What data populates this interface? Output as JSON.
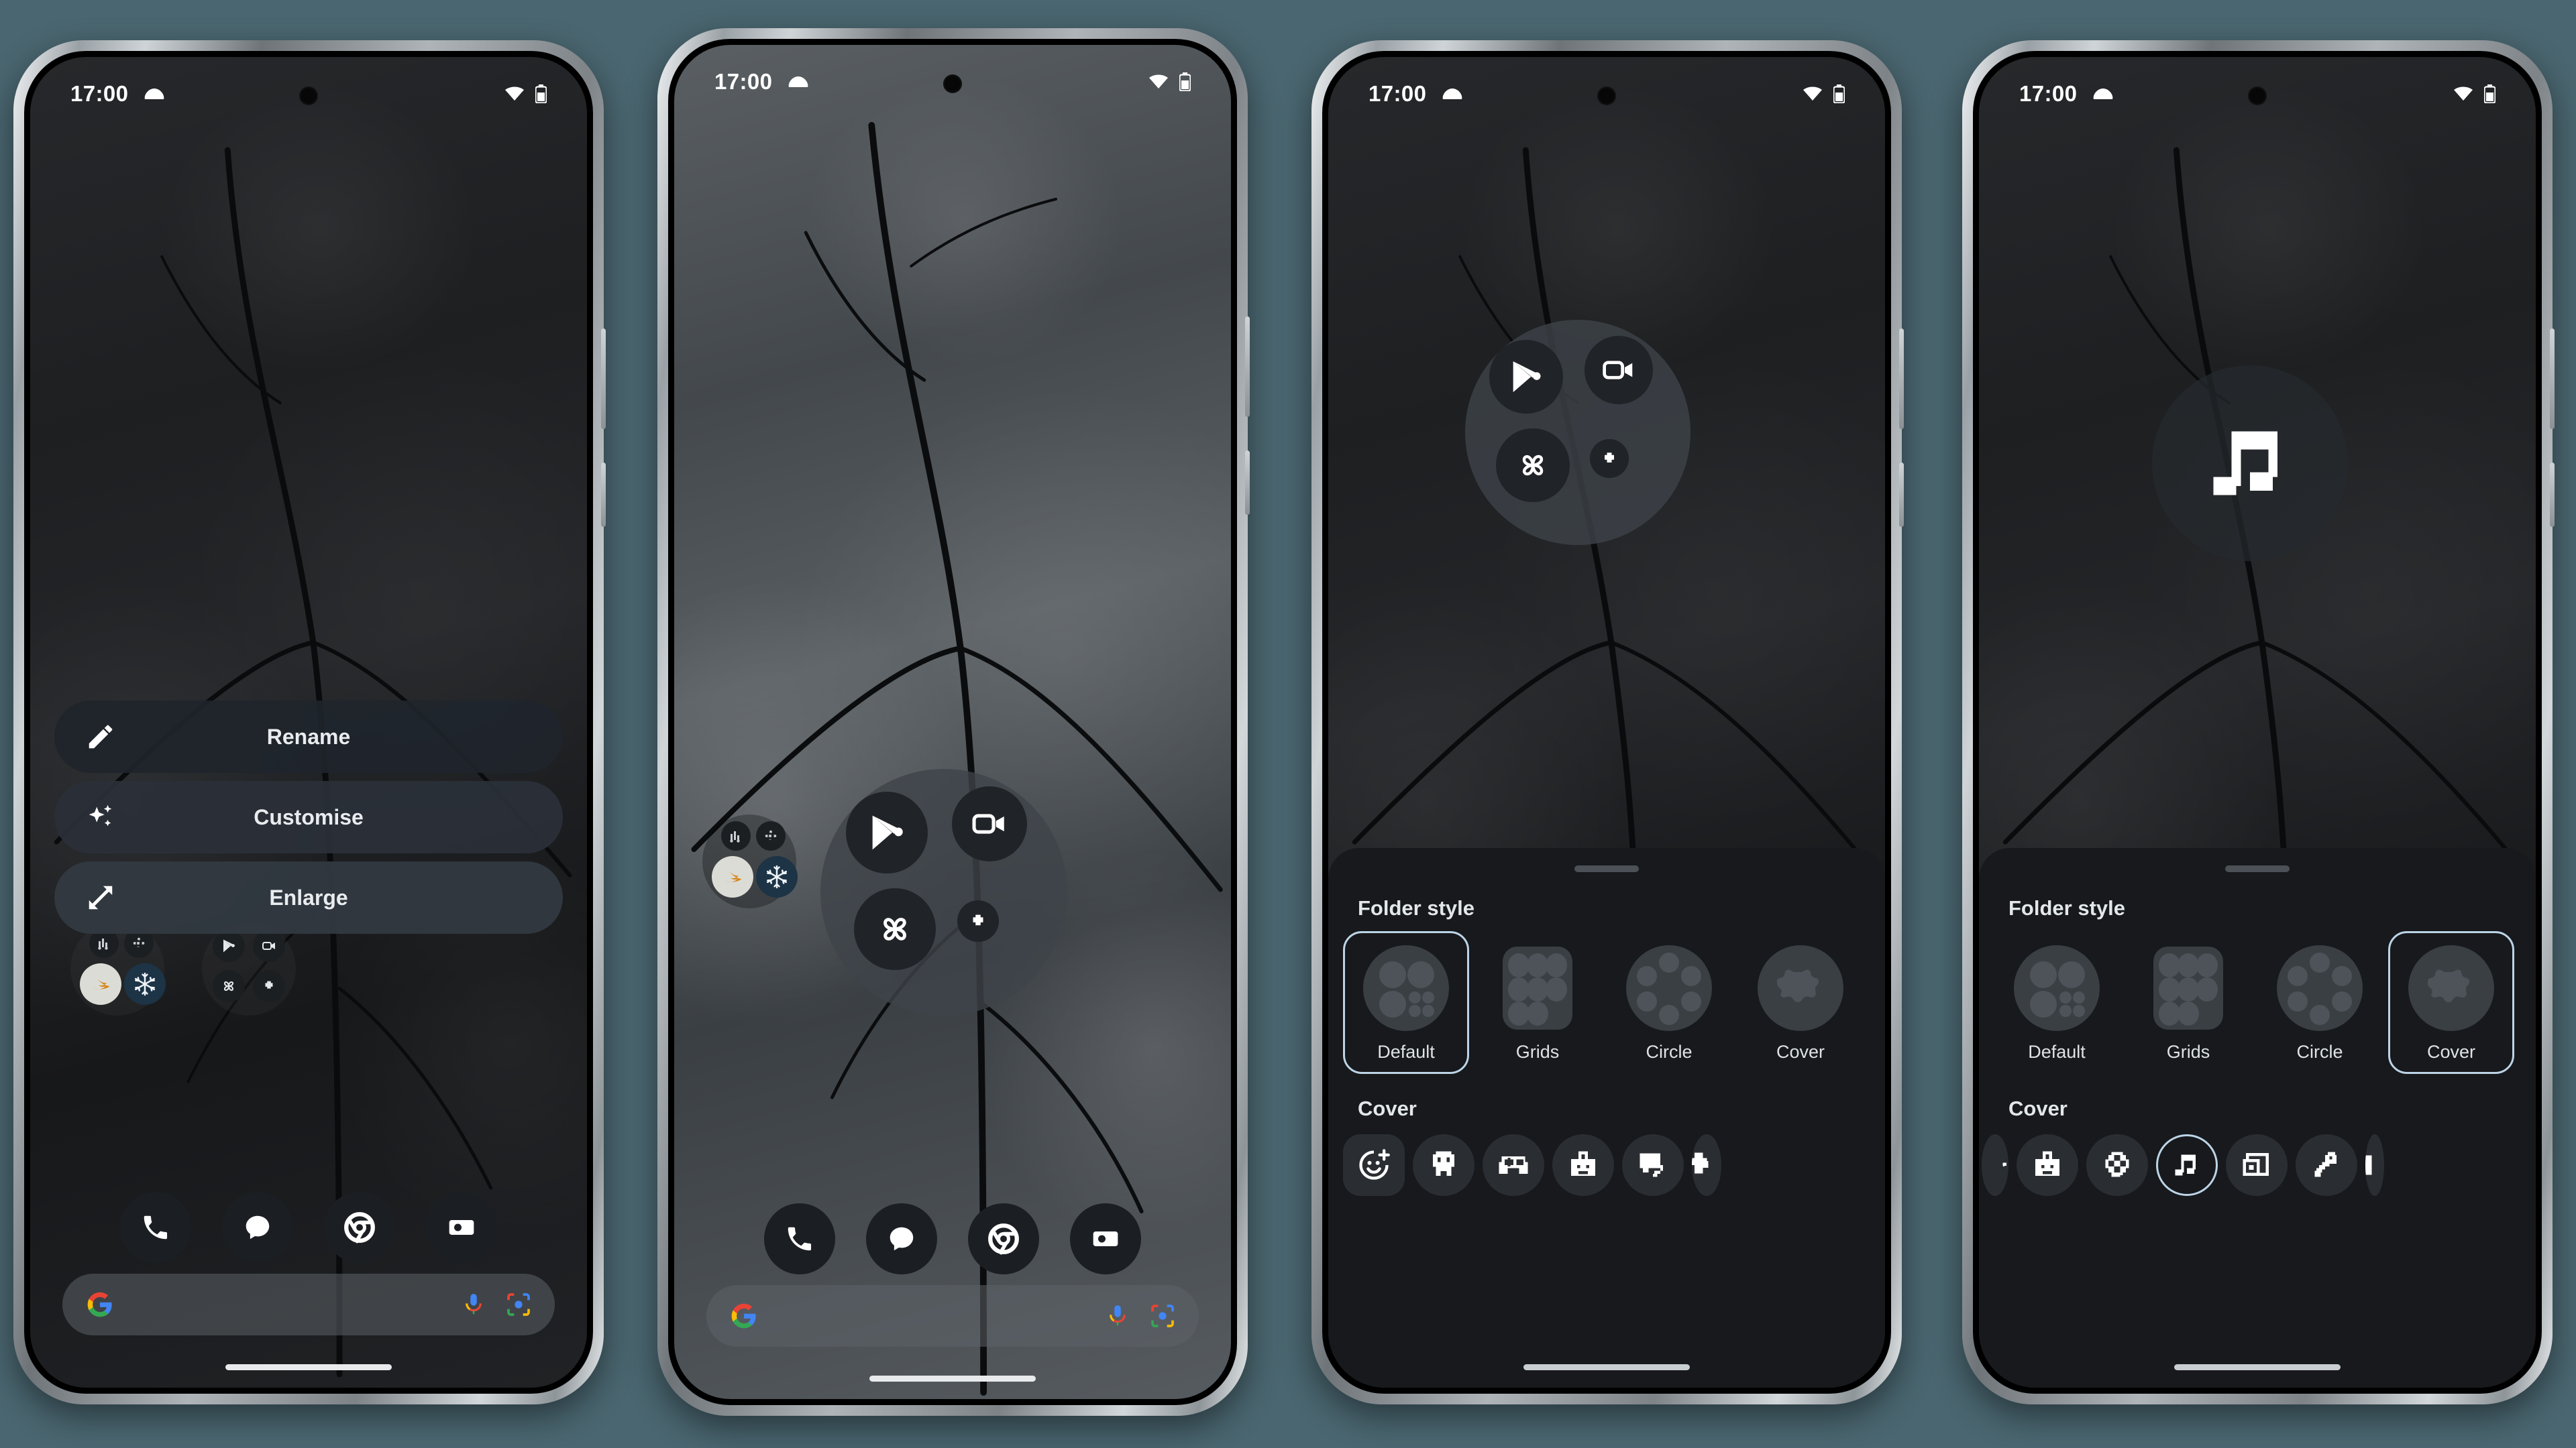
{
  "status_bar": {
    "time": "17:00",
    "weather_icon": "cloud-icon",
    "wifi_icon": "wifi-icon",
    "battery_icon": "battery-icon"
  },
  "phones": [
    {
      "id": "phone-1",
      "caption": "folder-context-menu",
      "context_menu": [
        {
          "icon": "pencil-icon",
          "label": "Rename"
        },
        {
          "icon": "sparkle-icon",
          "label": "Customise"
        },
        {
          "icon": "arrows-diagonal-icon",
          "label": "Enlarge"
        }
      ]
    },
    {
      "id": "phone-2",
      "caption": "folder-opened-default-style"
    },
    {
      "id": "phone-3",
      "caption": "folder-style-picker-default-selected",
      "sheet": {
        "folder_style_title": "Folder style",
        "styles": [
          {
            "label": "Default",
            "selected": true
          },
          {
            "label": "Grids",
            "selected": false
          },
          {
            "label": "Circle",
            "selected": false
          },
          {
            "label": "Cover",
            "selected": false
          }
        ],
        "cover_title": "Cover",
        "covers": [
          {
            "icon": "emoji-add-icon",
            "selected": false,
            "shape": "square"
          },
          {
            "icon": "robot-icon",
            "selected": false,
            "shape": "circle"
          },
          {
            "icon": "gamepad-icon",
            "selected": false,
            "shape": "circle"
          },
          {
            "icon": "briefcase-icon",
            "selected": false,
            "shape": "circle"
          },
          {
            "icon": "chat-bubbles-icon",
            "selected": false,
            "shape": "circle"
          },
          {
            "icon": "puzzle-icon",
            "selected": false,
            "shape": "circle"
          }
        ]
      }
    },
    {
      "id": "phone-4",
      "caption": "folder-style-picker-cover-selected",
      "sheet": {
        "folder_style_title": "Folder style",
        "styles": [
          {
            "label": "Default",
            "selected": false
          },
          {
            "label": "Grids",
            "selected": false
          },
          {
            "label": "Circle",
            "selected": false
          },
          {
            "label": "Cover",
            "selected": true
          }
        ],
        "cover_title": "Cover",
        "covers": [
          {
            "icon": "briefcase-icon",
            "selected": false,
            "shape": "circle"
          },
          {
            "icon": "film-reel-icon",
            "selected": false,
            "shape": "circle"
          },
          {
            "icon": "music-note-icon",
            "selected": true,
            "shape": "circle"
          },
          {
            "icon": "photos-frame-icon",
            "selected": false,
            "shape": "circle"
          },
          {
            "icon": "wrench-icon",
            "selected": false,
            "shape": "circle"
          }
        ]
      }
    }
  ],
  "folder_apps": [
    {
      "name": "play-store-icon"
    },
    {
      "name": "video-camera-icon"
    },
    {
      "name": "photos-pinwheel-icon"
    },
    {
      "name": "puzzle-piece-icon"
    }
  ],
  "dock": [
    {
      "name": "phone-icon"
    },
    {
      "name": "messages-icon"
    },
    {
      "name": "chrome-icon"
    },
    {
      "name": "camera-icon"
    }
  ],
  "search_bar": {
    "google_logo": "google-g-icon",
    "mic_icon": "microphone-icon",
    "lens_icon": "google-lens-icon"
  },
  "colors": {
    "accent_selected": "#bcd4e6",
    "sheet_bg": "#17191c",
    "menu_bg": "#202530",
    "text": "#e9ecef"
  }
}
